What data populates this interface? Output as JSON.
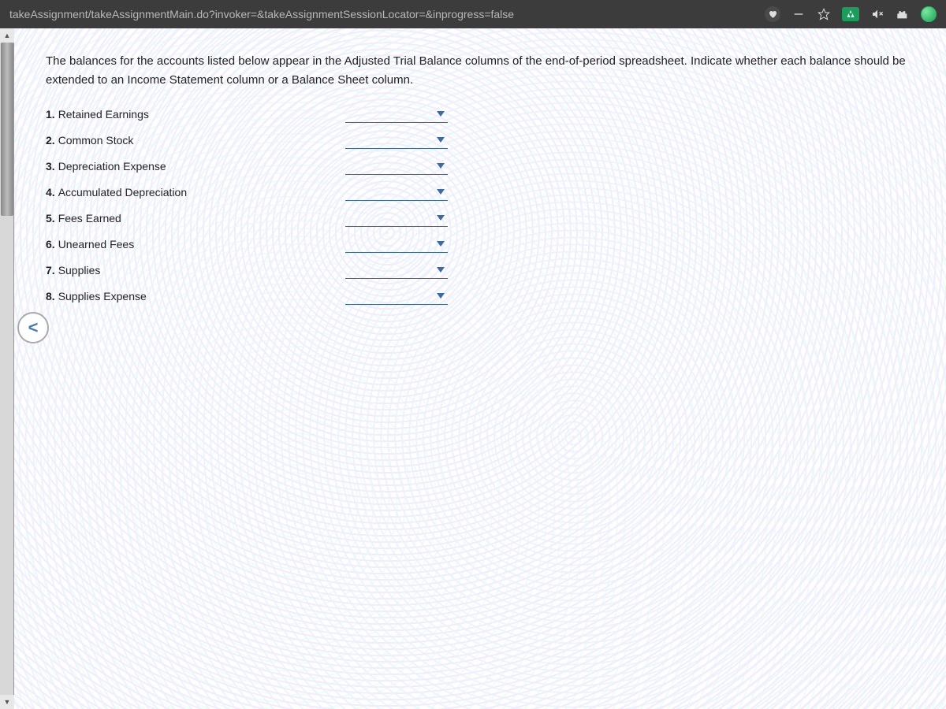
{
  "browser": {
    "url": "takeAssignment/takeAssignmentMain.do?invoker=&takeAssignmentSessionLocator=&inprogress=false"
  },
  "question": {
    "prompt": "The balances for the accounts listed below appear in the Adjusted Trial Balance columns of the end-of-period spreadsheet. Indicate whether each balance should be extended to an Income Statement column or a Balance Sheet column.",
    "items": [
      {
        "num": "1.",
        "label": "Retained Earnings"
      },
      {
        "num": "2.",
        "label": "Common Stock"
      },
      {
        "num": "3.",
        "label": "Depreciation Expense"
      },
      {
        "num": "4.",
        "label": "Accumulated Depreciation"
      },
      {
        "num": "5.",
        "label": "Fees Earned"
      },
      {
        "num": "6.",
        "label": "Unearned Fees"
      },
      {
        "num": "7.",
        "label": "Supplies"
      },
      {
        "num": "8.",
        "label": "Supplies Expense"
      }
    ]
  },
  "nav": {
    "prev": "<"
  }
}
